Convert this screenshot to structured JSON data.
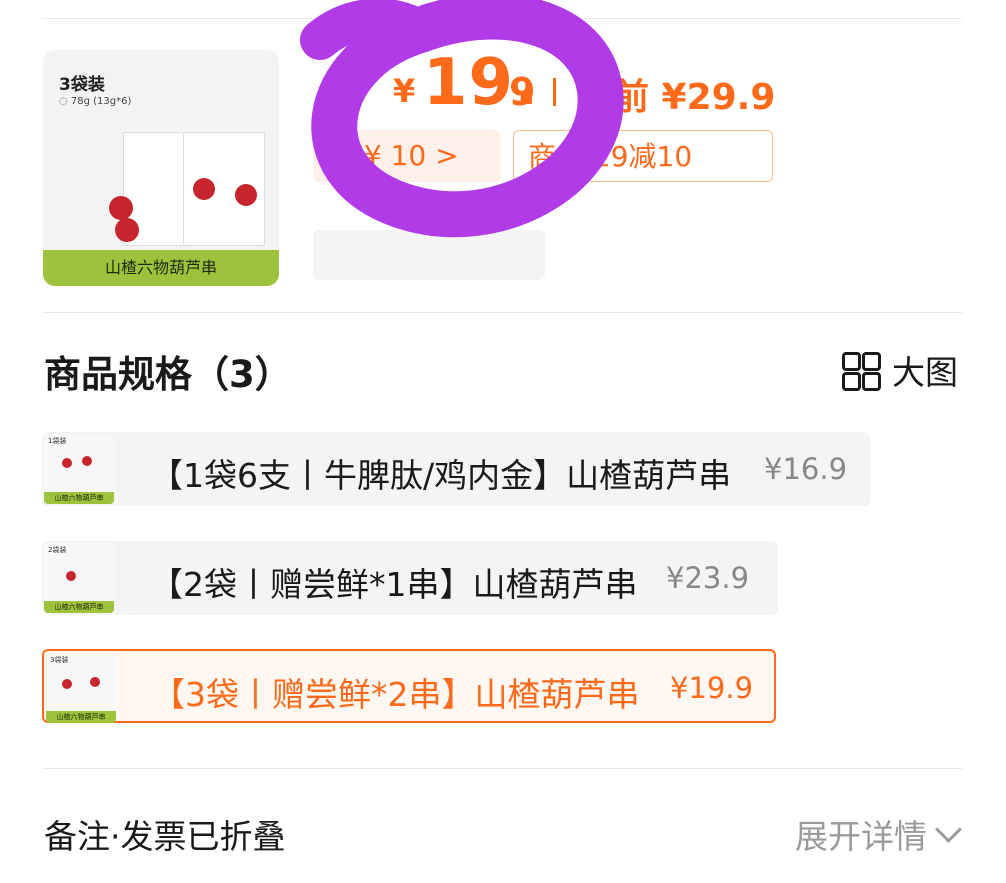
{
  "product": {
    "pack_title": "3袋装",
    "pack_sub": "◌ 78g (13g*6)",
    "name_bar": "山楂六物葫芦串",
    "price_symbol": "¥",
    "price_int": "19.",
    "price_dec": "9",
    "price_before": "前 ¥29.9",
    "promo_chip_1": "减 ¥ 10 >",
    "promo_chip_2": "商 满29减10"
  },
  "specs": {
    "title": "商品规格（3）",
    "large_view_label": "大图",
    "items": [
      {
        "thumb_title": "1袋装",
        "text": "【1袋6支丨牛脾肽/鸡内金】山楂葫芦串",
        "price": "¥16.9",
        "bar": "山楂六物葫芦串"
      },
      {
        "thumb_title": "2袋装",
        "text": "【2袋丨赠尝鲜*1串】山楂葫芦串",
        "price": "¥23.9",
        "bar": "山楂六物葫芦串"
      },
      {
        "thumb_title": "3袋装",
        "text": "【3袋丨赠尝鲜*2串】山楂葫芦串",
        "price": "¥19.9",
        "bar": "山楂六物葫芦串"
      }
    ]
  },
  "footer": {
    "remark": "备注·发票已折叠",
    "expand_label": "展开详情"
  },
  "colors": {
    "accent": "#ff6a1a",
    "bar_green": "#9dc33d",
    "overlay_purple": "#b23be8"
  }
}
